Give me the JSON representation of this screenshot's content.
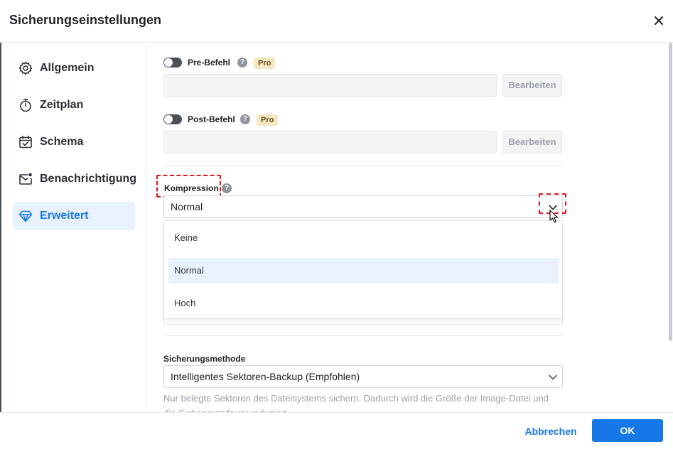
{
  "window": {
    "title": "Sicherungseinstellungen"
  },
  "sidebar": {
    "items": [
      {
        "label": "Allgemein",
        "icon": "gear-icon",
        "active": false
      },
      {
        "label": "Zeitplan",
        "icon": "stopwatch-icon",
        "active": false
      },
      {
        "label": "Schema",
        "icon": "calendar-check-icon",
        "active": false
      },
      {
        "label": "Benachrichtigung",
        "icon": "mail-notification-icon",
        "active": false
      },
      {
        "label": "Erweitert",
        "icon": "diamond-icon",
        "active": true
      }
    ]
  },
  "pre_command": {
    "label": "Pre-Befehl",
    "badge": "Pro",
    "value": "",
    "edit_label": "Bearbeiten",
    "enabled": false
  },
  "post_command": {
    "label": "Post-Befehl",
    "badge": "Pro",
    "value": "",
    "edit_label": "Bearbeiten",
    "enabled": false
  },
  "compression": {
    "label": "Kompression",
    "selected": "Normal",
    "options": [
      "Keine",
      "Normal",
      "Hoch"
    ]
  },
  "backup_method": {
    "label": "Sicherungsmethode",
    "selected": "Intelligentes Sektoren-Backup (Empfohlen)",
    "description": "Nur belegte Sektoren des Dateisystems sichern. Dadurch wird die Größe der Image-Datei und die Sicherungsdauer reduziert."
  },
  "footer": {
    "cancel_label": "Abbrechen",
    "ok_label": "OK"
  },
  "colors": {
    "accent": "#1677e6",
    "highlight": "#e0141e",
    "pro_badge": "#f5e7c4",
    "selected_bg": "#e8f2ff"
  }
}
